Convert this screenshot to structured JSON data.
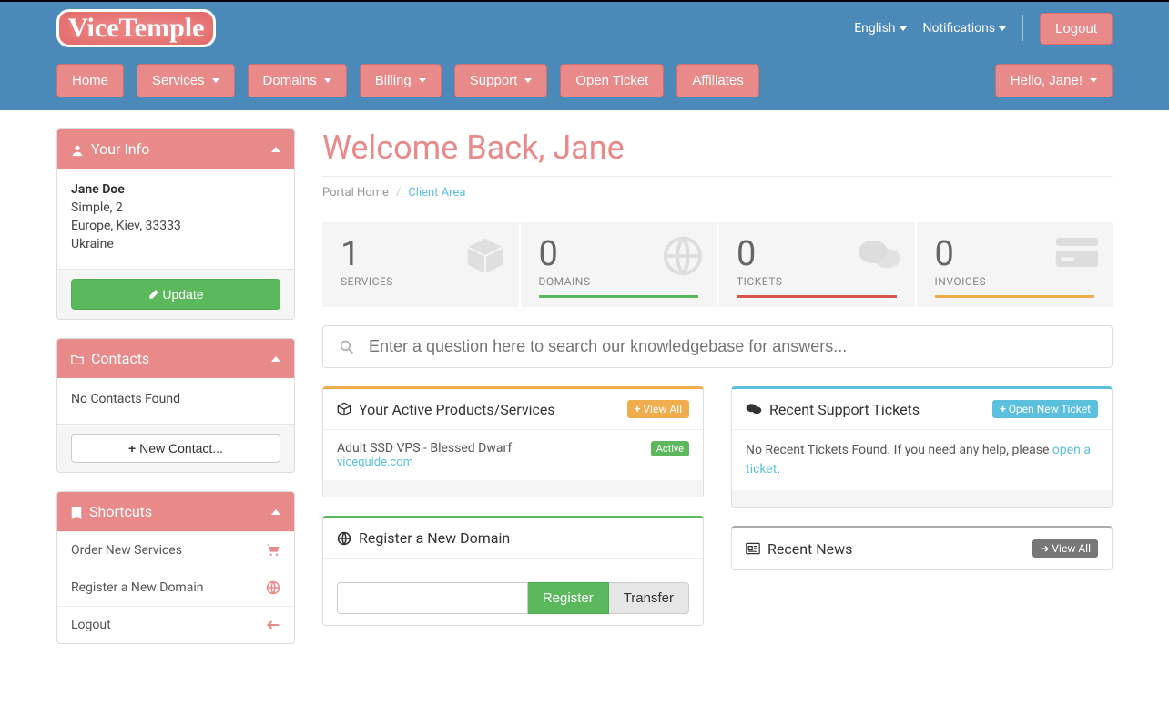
{
  "top": {
    "brand": "ViceTemple",
    "lang": "English",
    "notif": "Notifications",
    "logout": "Logout"
  },
  "nav": {
    "home": "Home",
    "services": "Services",
    "domains": "Domains",
    "billing": "Billing",
    "support": "Support",
    "open_ticket": "Open Ticket",
    "affiliates": "Affiliates",
    "hello": "Hello, Jane!"
  },
  "sidebar": {
    "info": {
      "title": "Your Info",
      "name": "Jane Doe",
      "line1": "Simple, 2",
      "line2": "Europe, Kiev, 33333",
      "line3": "Ukraine",
      "update": "Update"
    },
    "contacts": {
      "title": "Contacts",
      "empty": "No Contacts Found",
      "new": "New Contact..."
    },
    "shortcuts": {
      "title": "Shortcuts",
      "order": "Order New Services",
      "register": "Register a New Domain",
      "logout": "Logout"
    }
  },
  "main": {
    "welcome": "Welcome Back, Jane",
    "crumb_home": "Portal Home",
    "crumb_cur": "Client Area",
    "stats": {
      "services": {
        "n": "1",
        "l": "SERVICES",
        "c": "#5bc0de"
      },
      "domains": {
        "n": "0",
        "l": "DOMAINS",
        "c": "#5cb85c"
      },
      "tickets": {
        "n": "0",
        "l": "TICKETS",
        "c": "#d9534f"
      },
      "invoices": {
        "n": "0",
        "l": "INVOICES",
        "c": "#f0ad4e"
      }
    },
    "search_placeholder": "Enter a question here to search our knowledgebase for answers...",
    "products": {
      "title": "Your Active Products/Services",
      "view_all": "View All",
      "item_name": "Adult SSD VPS - Blessed Dwarf",
      "item_link": "viceguide.com",
      "item_status": "Active"
    },
    "register_domain": {
      "title": "Register a New Domain",
      "register": "Register",
      "transfer": "Transfer"
    },
    "tickets": {
      "title": "Recent Support Tickets",
      "open_new": "Open New Ticket",
      "empty_pre": "No Recent Tickets Found. If you need any help, please ",
      "empty_link": "open a ticket",
      "empty_post": "."
    },
    "news": {
      "title": "Recent News",
      "view_all": "View All"
    }
  }
}
